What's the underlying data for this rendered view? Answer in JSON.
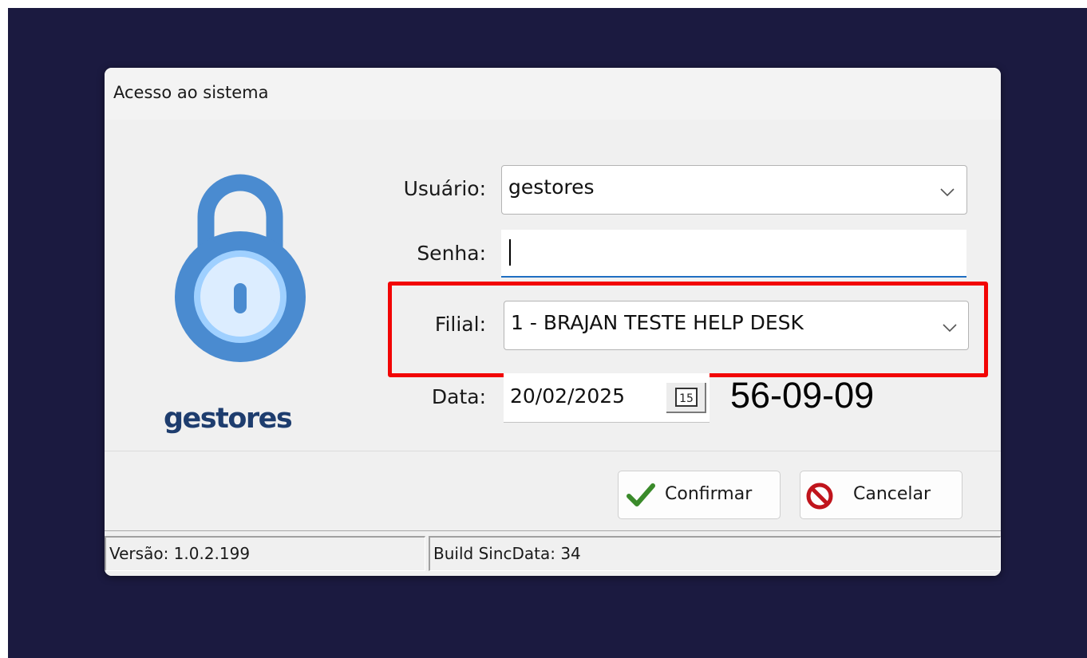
{
  "window": {
    "title": "Acesso ao sistema"
  },
  "brand": {
    "name": "gestores",
    "accent_color": "#1e3d6e"
  },
  "lock": {
    "icon": "padlock-icon",
    "color": "#4a8bd0"
  },
  "form": {
    "usuario": {
      "label": "Usuário:",
      "value": "gestores"
    },
    "senha": {
      "label": "Senha:",
      "value": ""
    },
    "filial": {
      "label": "Filial:",
      "value": "1 - BRAJAN TESTE HELP DESK"
    },
    "data": {
      "label": "Data:",
      "value": "20/02/2025",
      "calendar_icon_text": "15"
    },
    "code": "56-09-09"
  },
  "highlight": {
    "color": "#f20505"
  },
  "buttons": {
    "confirm_label": "Confirmar",
    "confirm_icon": "checkmark-icon",
    "cancel_label": "Cancelar",
    "cancel_icon": "prohibited-icon"
  },
  "status": {
    "version": "Versão: 1.0.2.199",
    "build": "Build SincData: 34"
  }
}
